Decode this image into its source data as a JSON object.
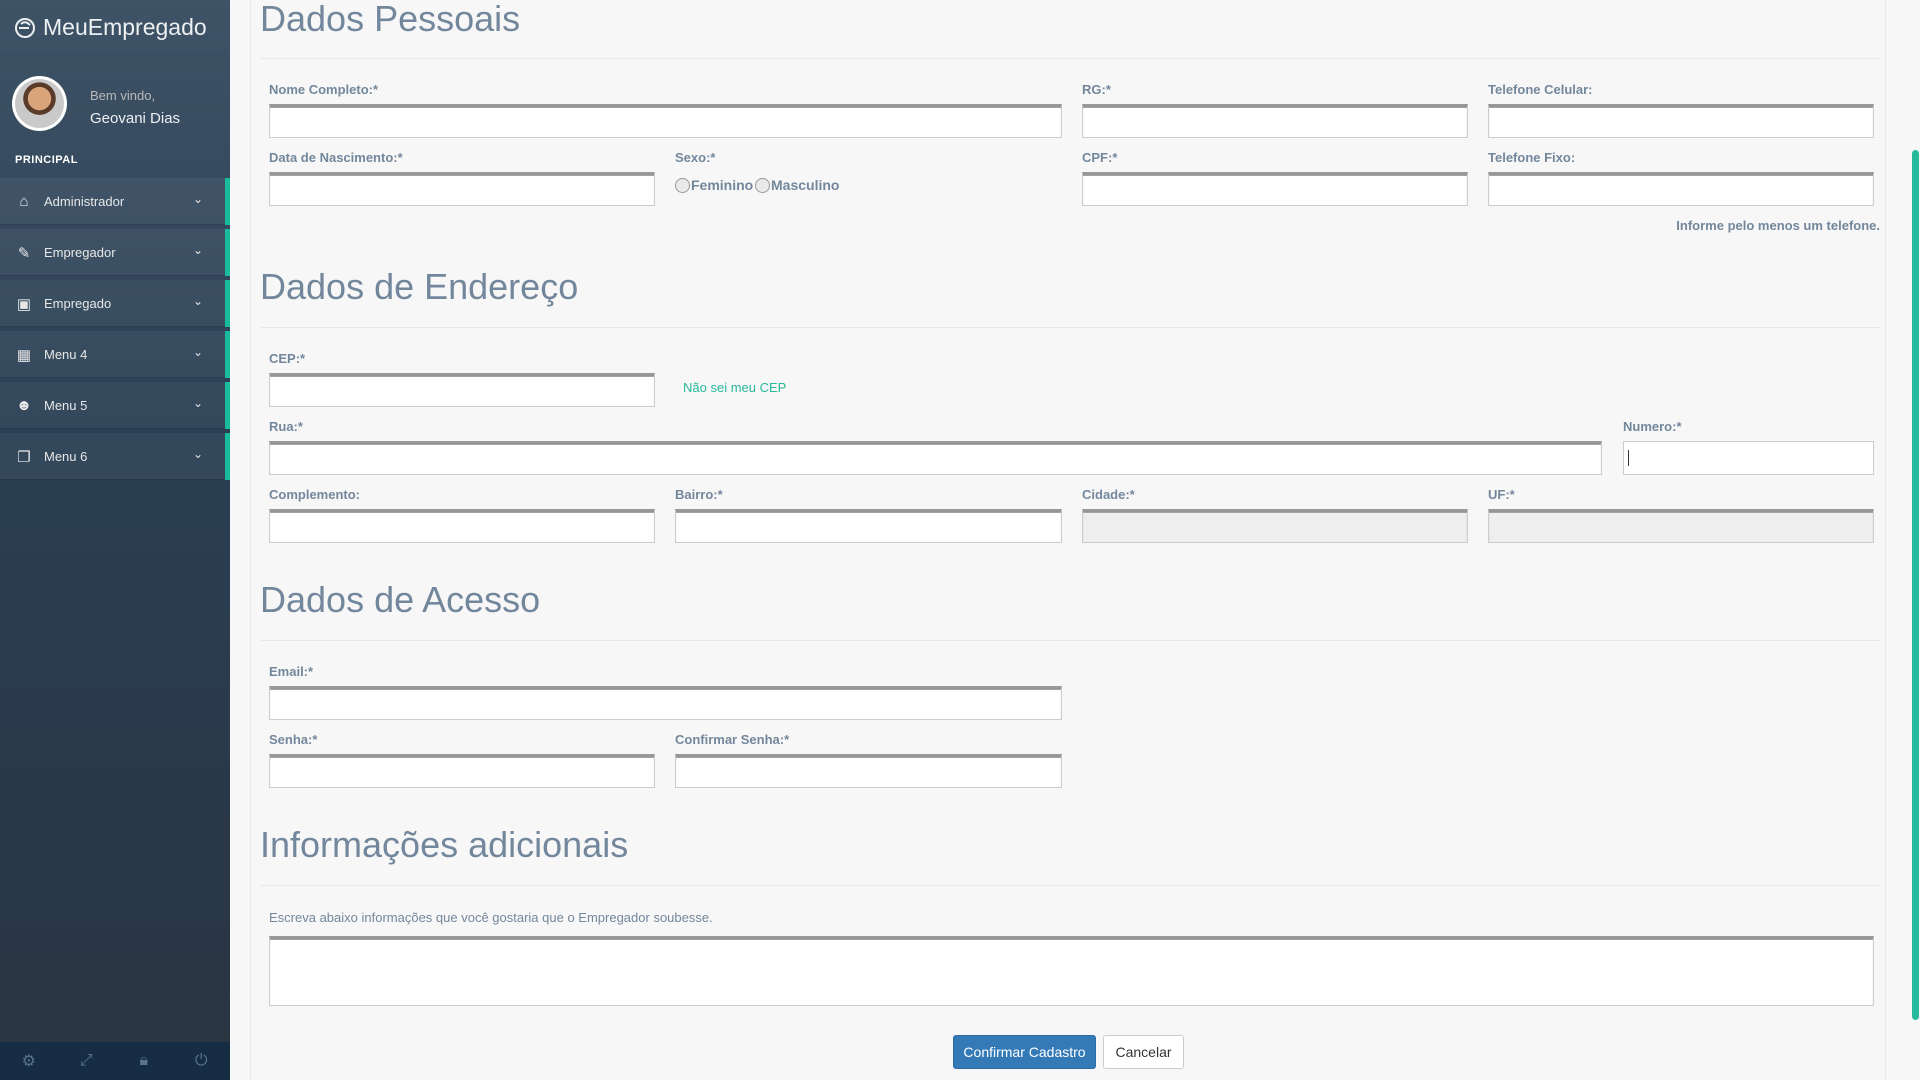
{
  "sidebar": {
    "brand": "MeuEmpregado",
    "welcome": "Bem vindo,",
    "username": "Geovani Dias",
    "section": "PRINCIPAL",
    "items": [
      {
        "label": "Administrador",
        "icon": "home-icon"
      },
      {
        "label": "Empregador",
        "icon": "edit-icon"
      },
      {
        "label": "Empregado",
        "icon": "contact-card-icon"
      },
      {
        "label": "Menu 4",
        "icon": "calendar-icon"
      },
      {
        "label": "Menu 5",
        "icon": "users-icon"
      },
      {
        "label": "Menu 6",
        "icon": "clone-icon"
      }
    ],
    "footer_icons": [
      "settings-icon",
      "fullscreen-icon",
      "lock-icon",
      "power-icon"
    ]
  },
  "form": {
    "personal_title": "Dados Pessoais",
    "nome_label": "Nome Completo:*",
    "rg_label": "RG:*",
    "celular_label": "Telefone Celular:",
    "nascimento_label": "Data de Nascimento:*",
    "sexo_label": "Sexo:*",
    "feminino": "Feminino",
    "masculino": "Masculino",
    "cpf_label": "CPF:*",
    "fixo_label": "Telefone Fixo:",
    "telefone_note": "Informe pelo menos um telefone.",
    "address_title": "Dados de Endereço",
    "cep_label": "CEP:*",
    "cep_link": "Não sei meu CEP",
    "rua_label": "Rua:*",
    "numero_label": "Numero:*",
    "complemento_label": "Complemento:",
    "bairro_label": "Bairro:*",
    "cidade_label": "Cidade:*",
    "uf_label": "UF:*",
    "access_title": "Dados de Acesso",
    "email_label": "Email:*",
    "senha_label": "Senha:*",
    "confirmar_label": "Confirmar Senha:*",
    "extra_title": "Informações adicionais",
    "extra_help": "Escreva abaixo informações que você gostaria que o Empregador soubesse.",
    "confirm_button": "Confirmar Cadastro",
    "cancel_button": "Cancelar"
  },
  "colors": {
    "accent": "#1abb9c",
    "primary": "#337ab7",
    "sidebar": "#2a3f54"
  }
}
